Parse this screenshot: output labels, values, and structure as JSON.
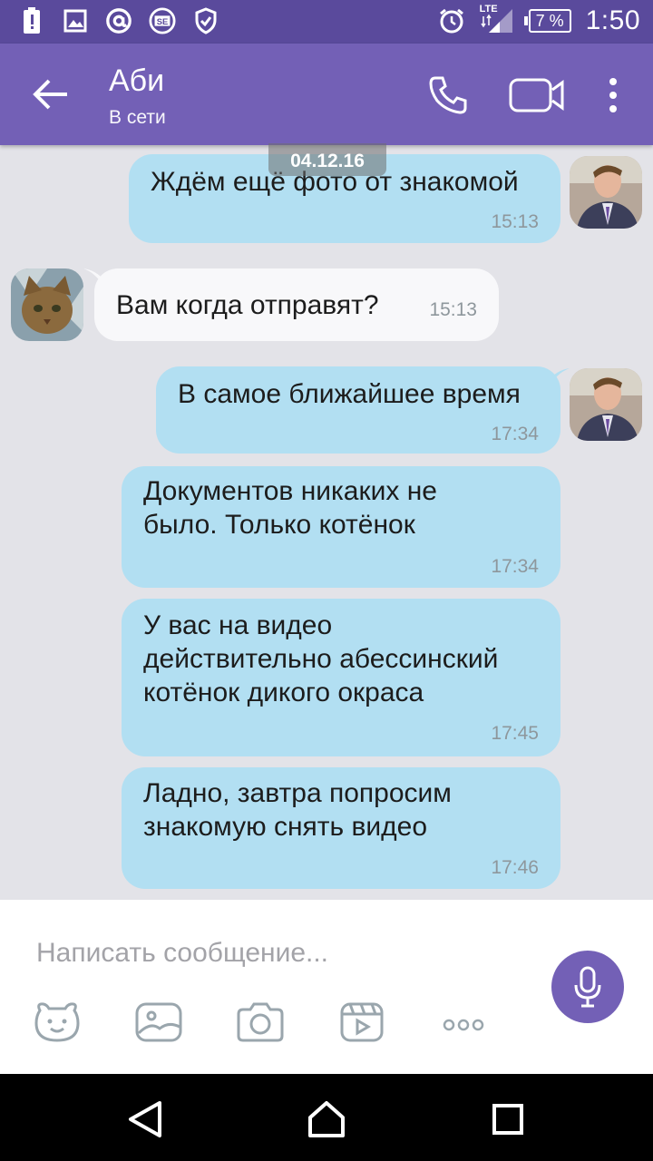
{
  "status_bar": {
    "time": "1:50",
    "battery_percent": "7 %",
    "network": "LTE",
    "icons_left": [
      "battery-alert-icon",
      "image-icon",
      "at-icon",
      "se-app-icon",
      "shield-check-icon"
    ],
    "icons_right": [
      "alarm-icon",
      "lte-signal-icon",
      "battery-icon"
    ]
  },
  "header": {
    "contact_name": "Аби",
    "contact_status": "В сети"
  },
  "date_separator": "04.12.16",
  "messages": [
    {
      "direction": "out",
      "text": "Ждём ещё фото от знакомой",
      "time": "15:13"
    },
    {
      "direction": "in",
      "text": "Вам когда отправят?",
      "time": "15:13"
    },
    {
      "direction": "out",
      "text": "В самое ближайшее время",
      "time": "17:34"
    },
    {
      "direction": "out",
      "text": "Документов никаких не\nбыло. Только котёнок",
      "time": "17:34"
    },
    {
      "direction": "out",
      "text": "У вас на видео\nдействительно абессинский\nкотёнок дикого окраса",
      "time": "17:45"
    },
    {
      "direction": "out",
      "text": "Ладно, завтра попросим\nзнакомую снять видео",
      "time": "17:46"
    }
  ],
  "composer": {
    "placeholder": "Написать сообщение..."
  },
  "colors": {
    "status_bar": "#5a4a9c",
    "header": "#7360b6",
    "outgoing_bubble": "#b2dff2",
    "incoming_bubble": "#f8f8fa",
    "chat_background": "#e3e3e8"
  }
}
